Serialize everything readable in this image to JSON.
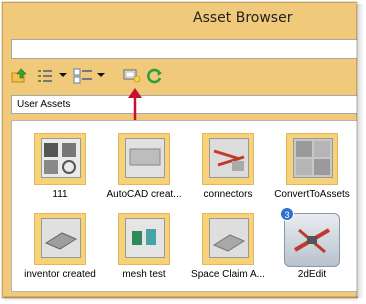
{
  "window": {
    "title": "Asset Browser"
  },
  "search": {
    "value": "",
    "placeholder": ""
  },
  "toolbar": {
    "buttons": [
      {
        "name": "add-asset-button",
        "icon": "folder-import-icon"
      },
      {
        "name": "view-list-button",
        "icon": "list-view-icon"
      },
      {
        "name": "view-details-button",
        "icon": "details-view-icon"
      },
      {
        "name": "preview-button",
        "icon": "preview-bulb-icon"
      },
      {
        "name": "refresh-button",
        "icon": "refresh-icon"
      }
    ]
  },
  "path": {
    "label": "User Assets"
  },
  "assets": [
    {
      "label": "111"
    },
    {
      "label": "AutoCAD creat..."
    },
    {
      "label": "connectors"
    },
    {
      "label": "ConvertToAssets"
    },
    {
      "label": "inventor created"
    },
    {
      "label": "mesh test"
    },
    {
      "label": "Space Claim A..."
    },
    {
      "label": "2dEdit",
      "badge": "3"
    }
  ],
  "colors": {
    "window_bg": "#f0c97b",
    "folder": "#f6d37a",
    "annotation_arrow": "#c8102e",
    "badge": "#2f6fcf"
  }
}
